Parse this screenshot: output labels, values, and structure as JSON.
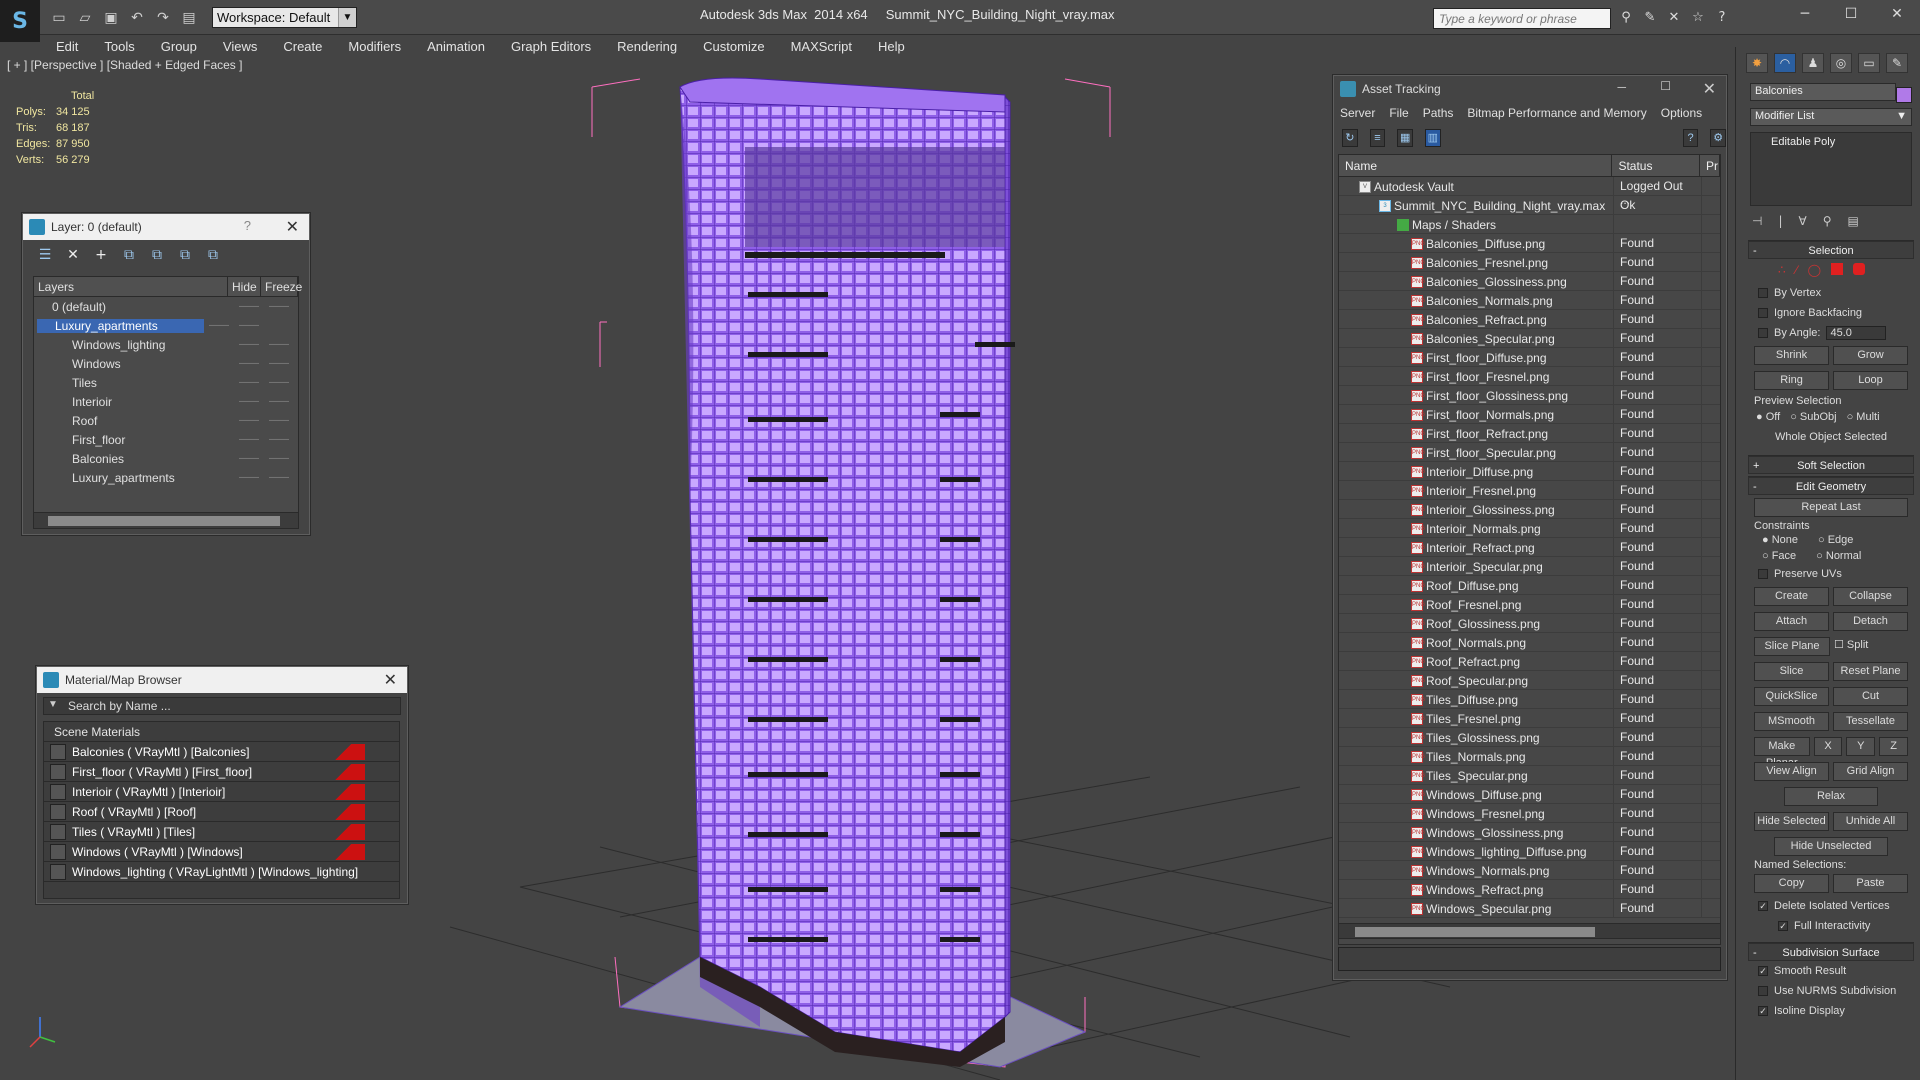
{
  "app": {
    "logo": "S",
    "title": "Autodesk 3ds Max  2014 x64     Summit_NYC_Building_Night_vray.max",
    "workspace": "Workspace: Default",
    "search_placeholder": "Type a keyword or phrase"
  },
  "menu": [
    "Edit",
    "Tools",
    "Group",
    "Views",
    "Create",
    "Modifiers",
    "Animation",
    "Graph Editors",
    "Rendering",
    "Customize",
    "MAXScript",
    "Help"
  ],
  "viewport": {
    "label": "[ + ] [Perspective ] [Shaded + Edged Faces ]",
    "stats": {
      "header": "Total",
      "rows": [
        {
          "label": "Polys:",
          "value": "34 125"
        },
        {
          "label": "Tris:",
          "value": "68 187"
        },
        {
          "label": "Edges:",
          "value": "87 950"
        },
        {
          "label": "Verts:",
          "value": "56 279"
        }
      ]
    }
  },
  "layers_panel": {
    "title": "Layer: 0 (default)",
    "help": "?",
    "col_layers": "Layers",
    "col_hide": "Hide",
    "col_freeze": "Freeze",
    "rows": [
      {
        "name": "0 (default)",
        "child": false,
        "selected": false
      },
      {
        "name": "Luxury_apartments",
        "child": false,
        "selected": true
      },
      {
        "name": "Windows_lighting",
        "child": true,
        "selected": false
      },
      {
        "name": "Windows",
        "child": true,
        "selected": false
      },
      {
        "name": "Tiles",
        "child": true,
        "selected": false
      },
      {
        "name": "Interioir",
        "child": true,
        "selected": false
      },
      {
        "name": "Roof",
        "child": true,
        "selected": false
      },
      {
        "name": "First_floor",
        "child": true,
        "selected": false
      },
      {
        "name": "Balconies",
        "child": true,
        "selected": false
      },
      {
        "name": "Luxury_apartments",
        "child": true,
        "selected": false
      }
    ]
  },
  "material_browser": {
    "title": "Material/Map Browser",
    "search_placeholder": "Search by Name ...",
    "group": "Scene Materials",
    "items": [
      {
        "name": "Balconies  ( VRayMtl ) [Balconies]",
        "flag": true
      },
      {
        "name": "First_floor  ( VRayMtl ) [First_floor]",
        "flag": true
      },
      {
        "name": "Interioir  ( VRayMtl ) [Interioir]",
        "flag": true
      },
      {
        "name": "Roof  ( VRayMtl ) [Roof]",
        "flag": true
      },
      {
        "name": "Tiles  ( VRayMtl ) [Tiles]",
        "flag": true
      },
      {
        "name": "Windows  ( VRayMtl ) [Windows]",
        "flag": true
      },
      {
        "name": "Windows_lighting  ( VRayLightMtl ) [Windows_lighting]",
        "flag": false
      }
    ]
  },
  "asset_tracking": {
    "title": "Asset Tracking",
    "menu": [
      "Server",
      "File",
      "Paths",
      "Bitmap Performance and Memory",
      "Options"
    ],
    "col_name": "Name",
    "col_status": "Status",
    "col_extra": "Pr",
    "vault": {
      "name": "Autodesk Vault",
      "status": "Logged Out ..."
    },
    "file": {
      "name": "Summit_NYC_Building_Night_vray.max",
      "status": "Ok"
    },
    "folder": "Maps / Shaders",
    "assets": [
      {
        "name": "Balconies_Diffuse.png",
        "status": "Found"
      },
      {
        "name": "Balconies_Fresnel.png",
        "status": "Found"
      },
      {
        "name": "Balconies_Glossiness.png",
        "status": "Found"
      },
      {
        "name": "Balconies_Normals.png",
        "status": "Found"
      },
      {
        "name": "Balconies_Refract.png",
        "status": "Found"
      },
      {
        "name": "Balconies_Specular.png",
        "status": "Found"
      },
      {
        "name": "First_floor_Diffuse.png",
        "status": "Found"
      },
      {
        "name": "First_floor_Fresnel.png",
        "status": "Found"
      },
      {
        "name": "First_floor_Glossiness.png",
        "status": "Found"
      },
      {
        "name": "First_floor_Normals.png",
        "status": "Found"
      },
      {
        "name": "First_floor_Refract.png",
        "status": "Found"
      },
      {
        "name": "First_floor_Specular.png",
        "status": "Found"
      },
      {
        "name": "Interioir_Diffuse.png",
        "status": "Found"
      },
      {
        "name": "Interioir_Fresnel.png",
        "status": "Found"
      },
      {
        "name": "Interioir_Glossiness.png",
        "status": "Found"
      },
      {
        "name": "Interioir_Normals.png",
        "status": "Found"
      },
      {
        "name": "Interioir_Refract.png",
        "status": "Found"
      },
      {
        "name": "Interioir_Specular.png",
        "status": "Found"
      },
      {
        "name": "Roof_Diffuse.png",
        "status": "Found"
      },
      {
        "name": "Roof_Fresnel.png",
        "status": "Found"
      },
      {
        "name": "Roof_Glossiness.png",
        "status": "Found"
      },
      {
        "name": "Roof_Normals.png",
        "status": "Found"
      },
      {
        "name": "Roof_Refract.png",
        "status": "Found"
      },
      {
        "name": "Roof_Specular.png",
        "status": "Found"
      },
      {
        "name": "Tiles_Diffuse.png",
        "status": "Found"
      },
      {
        "name": "Tiles_Fresnel.png",
        "status": "Found"
      },
      {
        "name": "Tiles_Glossiness.png",
        "status": "Found"
      },
      {
        "name": "Tiles_Normals.png",
        "status": "Found"
      },
      {
        "name": "Tiles_Specular.png",
        "status": "Found"
      },
      {
        "name": "Windows_Diffuse.png",
        "status": "Found"
      },
      {
        "name": "Windows_Fresnel.png",
        "status": "Found"
      },
      {
        "name": "Windows_Glossiness.png",
        "status": "Found"
      },
      {
        "name": "Windows_lighting_Diffuse.png",
        "status": "Found"
      },
      {
        "name": "Windows_Normals.png",
        "status": "Found"
      },
      {
        "name": "Windows_Refract.png",
        "status": "Found"
      },
      {
        "name": "Windows_Specular.png",
        "status": "Found"
      }
    ]
  },
  "command_panel": {
    "object_name": "Balconies",
    "object_color": "#b07ae8",
    "modifier_list": "Modifier List",
    "stack_item": "Editable Poly",
    "selection": {
      "title": "Selection",
      "by_vertex": "By Vertex",
      "ignore_backfacing": "Ignore Backfacing",
      "by_angle": "By Angle:",
      "angle_value": "45.0",
      "shrink": "Shrink",
      "grow": "Grow",
      "ring": "Ring",
      "loop": "Loop",
      "preview": "Preview Selection",
      "off": "Off",
      "subobj": "SubObj",
      "multi": "Multi",
      "status": "Whole Object Selected"
    },
    "soft_selection": "Soft Selection",
    "edit_geometry": {
      "title": "Edit Geometry",
      "repeat_last": "Repeat Last",
      "constraints": "Constraints",
      "none": "None",
      "edge": "Edge",
      "face": "Face",
      "normal": "Normal",
      "preserve_uvs": "Preserve UVs",
      "create": "Create",
      "collapse": "Collapse",
      "attach": "Attach",
      "detach": "Detach",
      "slice_plane": "Slice Plane",
      "split": "Split",
      "slice": "Slice",
      "reset_plane": "Reset Plane",
      "quickslice": "QuickSlice",
      "cut": "Cut",
      "msmooth": "MSmooth",
      "tessellate": "Tessellate",
      "make_planar": "Make Planar",
      "x": "X",
      "y": "Y",
      "z": "Z",
      "view_align": "View Align",
      "grid_align": "Grid Align",
      "relax": "Relax",
      "hide_selected": "Hide Selected",
      "unhide_all": "Unhide All",
      "hide_unselected": "Hide Unselected",
      "named_selections": "Named Selections:",
      "copy": "Copy",
      "paste": "Paste",
      "delete_isolated": "Delete Isolated Vertices",
      "full_interactivity": "Full Interactivity"
    },
    "subdivision": {
      "title": "Subdivision Surface",
      "smooth_result": "Smooth Result",
      "use_nurms": "Use NURMS Subdivision",
      "isoline": "Isoline Display"
    }
  }
}
